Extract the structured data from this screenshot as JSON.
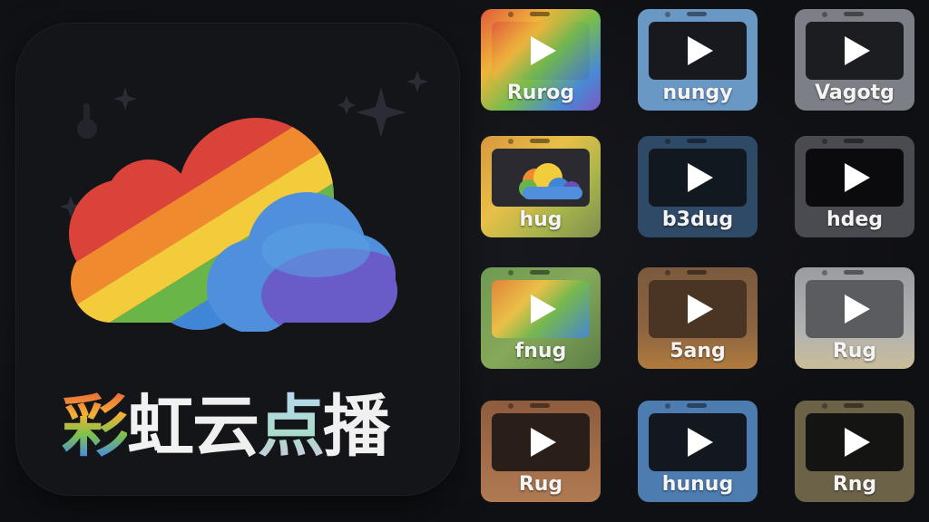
{
  "app": {
    "title_chars": [
      "彩",
      "虹",
      "云",
      "点",
      "播"
    ]
  },
  "tiles": [
    {
      "label": "Rurog"
    },
    {
      "label": "nungy"
    },
    {
      "label": "Vagotg"
    },
    {
      "label": "hug"
    },
    {
      "label": "b3dug"
    },
    {
      "label": "hdeg"
    },
    {
      "label": "fnug"
    },
    {
      "label": "5ang"
    },
    {
      "label": "Rug"
    },
    {
      "label": "Rug"
    },
    {
      "label": "hunug"
    },
    {
      "label": "Rng"
    }
  ],
  "colors": {
    "background": "#0f1014",
    "rainbow_red": "#d9433a",
    "rainbow_orange": "#ef8a2f",
    "rainbow_yellow": "#f2cc3a",
    "rainbow_green": "#69b548",
    "rainbow_blue": "#3f86d6",
    "rainbow_purple": "#6a4fb4"
  },
  "icons": [
    "rainbow-cloud-logo",
    "play-icon",
    "sparkle-icon"
  ]
}
